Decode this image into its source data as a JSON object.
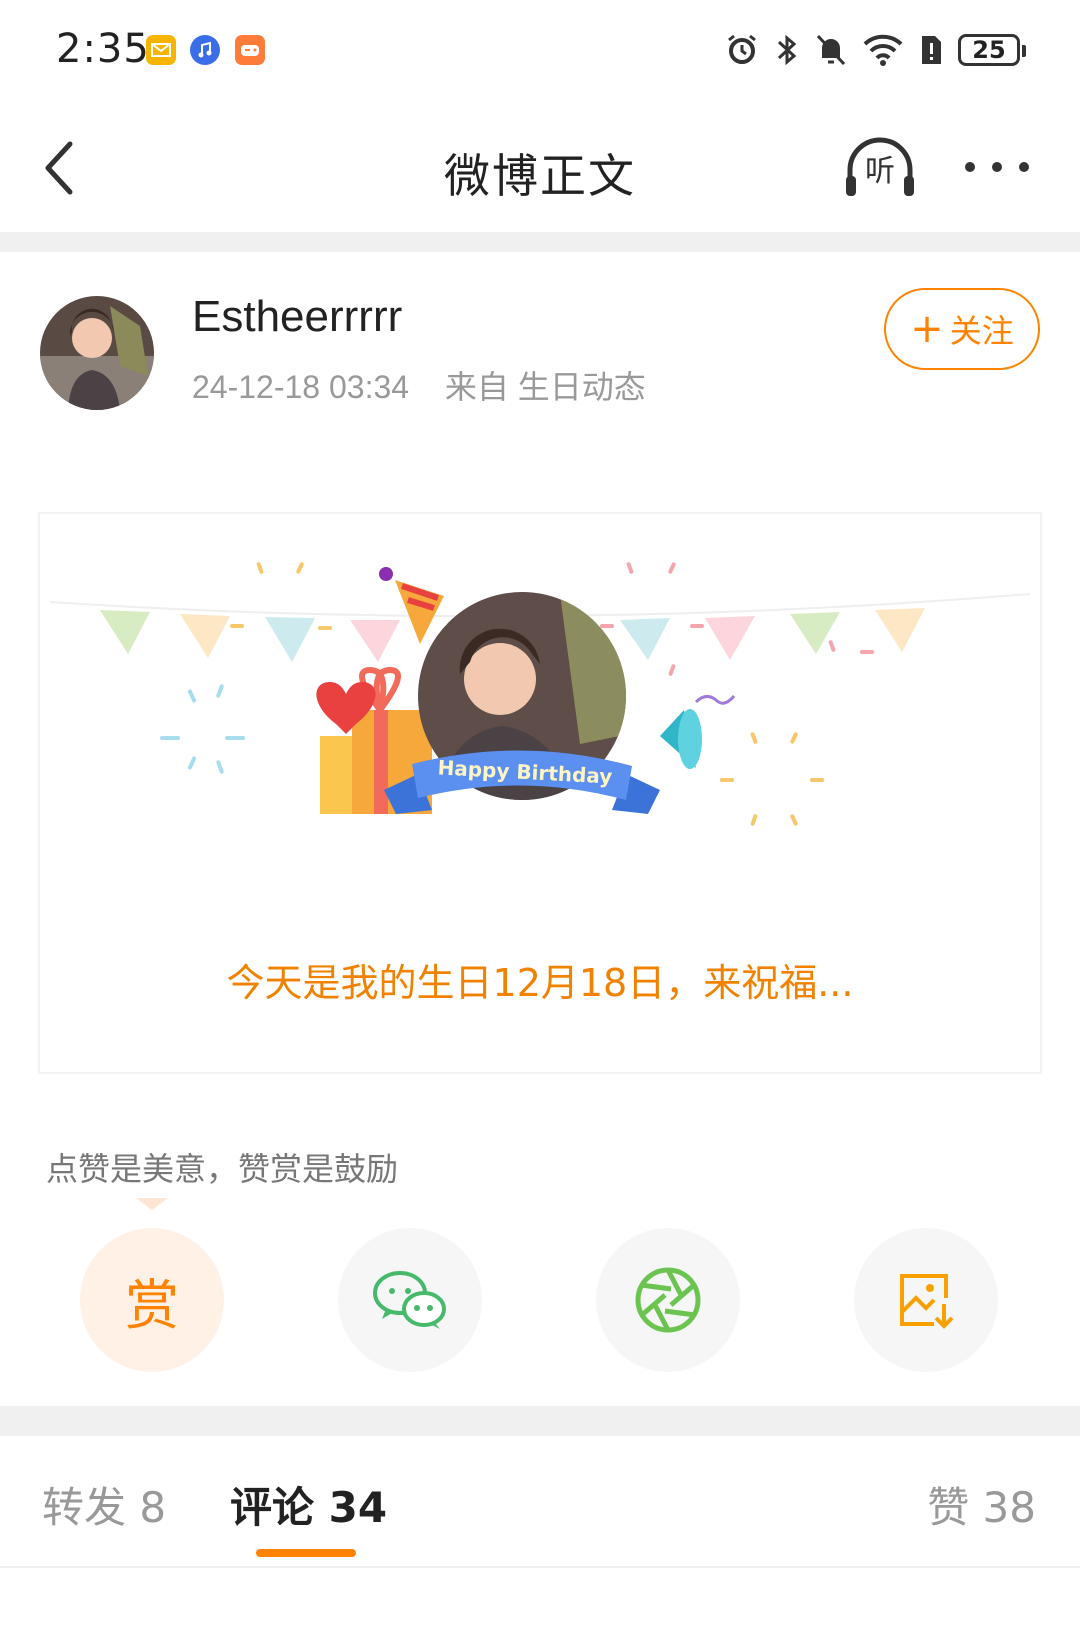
{
  "status_bar": {
    "time": "2:35",
    "app_icons": [
      "mail-icon",
      "music-icon",
      "game-icon"
    ],
    "right_icons": [
      "alarm-icon",
      "bluetooth-icon",
      "mute-icon",
      "wifi-icon",
      "sim-alert-icon"
    ],
    "battery": "25"
  },
  "nav": {
    "title": "微博正文",
    "back_icon": "back-arrow-icon",
    "listen_icon": "headphones-icon",
    "listen_label": "听",
    "more_icon": "more-icon"
  },
  "post": {
    "author": "Estheerrrrr",
    "timestamp": "24-12-18 03:34",
    "source": "来自 生日动态",
    "follow_label": "关注",
    "follow_prefix": "+",
    "card": {
      "banner_text": "Happy Birthday",
      "caption": "今天是我的生日12月18日，来祝福..."
    }
  },
  "reward": {
    "tip": "点赞是美意，赞赏是鼓励",
    "reward_label": "赏",
    "actions": [
      "wechat-icon",
      "moments-icon",
      "save-image-icon"
    ]
  },
  "tabs": [
    {
      "label": "转发 8"
    },
    {
      "label": "评论 34",
      "active": true
    },
    {
      "label": "赞 38"
    }
  ],
  "colors": {
    "accent": "#ff8200",
    "wechat": "#46b96b",
    "moments": "#6ac44f"
  }
}
